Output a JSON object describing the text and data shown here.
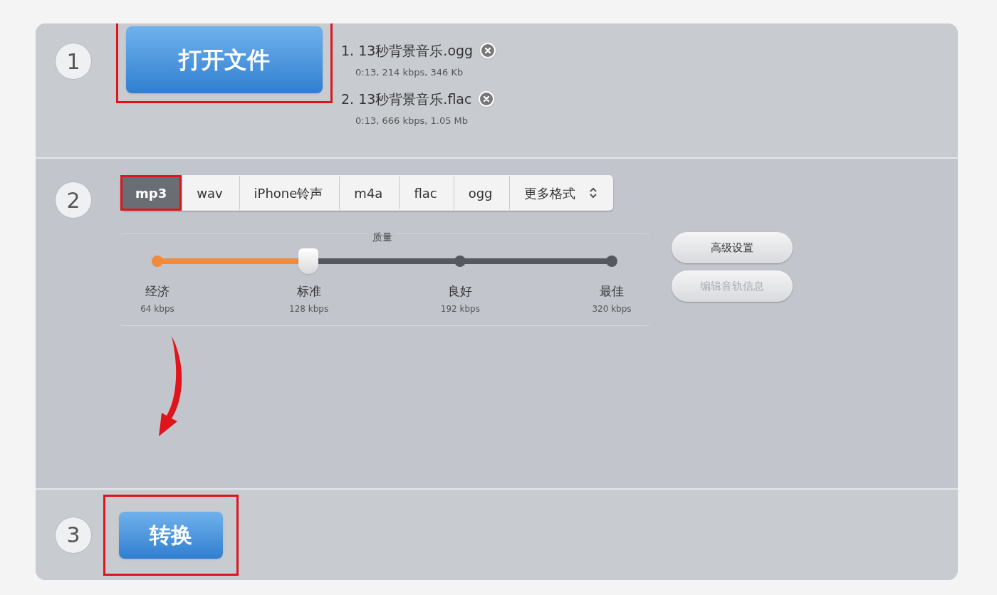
{
  "steps": [
    {
      "number": "1"
    },
    {
      "number": "2"
    },
    {
      "number": "3"
    }
  ],
  "open_button": {
    "label": "打开文件",
    "highlighted": true
  },
  "files": [
    {
      "name": "1. 13秒背景音乐.ogg",
      "info": "0:13, 214 kbps, 346 Kb"
    },
    {
      "name": "2. 13秒背景音乐.flac",
      "info": "0:13, 666 kbps, 1.05 Mb"
    }
  ],
  "formats": [
    {
      "label": "mp3",
      "selected": true,
      "highlighted": true
    },
    {
      "label": "wav",
      "selected": false,
      "highlighted": false
    },
    {
      "label": "iPhone铃声",
      "selected": false,
      "highlighted": false
    },
    {
      "label": "m4a",
      "selected": false,
      "highlighted": false
    },
    {
      "label": "flac",
      "selected": false,
      "highlighted": false
    },
    {
      "label": "ogg",
      "selected": false,
      "highlighted": false
    },
    {
      "label": "更多格式",
      "selected": false,
      "highlighted": false,
      "kind": "dropdown"
    }
  ],
  "quality": {
    "title": "质量",
    "level": 0.333,
    "stops": [
      {
        "label": "经济",
        "rate": "64 kbps"
      },
      {
        "label": "标准",
        "rate": "128 kbps"
      },
      {
        "label": "良好",
        "rate": "192 kbps"
      },
      {
        "label": "最佳",
        "rate": "320 kbps"
      }
    ]
  },
  "side_buttons": [
    {
      "label": "高级设置",
      "disabled": false
    },
    {
      "label": "编辑音轨信息",
      "disabled": true
    }
  ],
  "convert_button": {
    "label": "转换",
    "highlighted": true
  }
}
